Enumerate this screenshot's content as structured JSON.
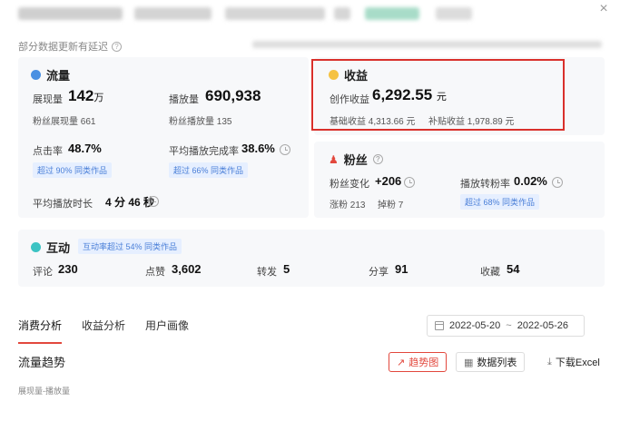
{
  "header": {
    "close_icon": "close-icon"
  },
  "notice": {
    "text": "部分数据更新有延迟"
  },
  "traffic": {
    "title": "流量",
    "impressions_label": "展现量",
    "impressions_value": "142",
    "impressions_unit": "万",
    "plays_label": "播放量",
    "plays_value": "690,938",
    "fan_impressions": "粉丝展现量 661",
    "fan_plays": "粉丝播放量 135",
    "ctr_label": "点击率",
    "ctr_value": "48.7%",
    "ctr_badge": "超过 90% 同类作品",
    "completion_label": "平均播放完成率",
    "completion_value": "38.6%",
    "completion_badge": "超过 66% 同类作品",
    "duration_label": "平均播放时长",
    "duration_value": "4 分 46 秒"
  },
  "revenue": {
    "title": "收益",
    "creation_label": "创作收益",
    "creation_value": "6,292.55",
    "creation_unit": "元",
    "base_label": "基础收益",
    "base_value": "4,313.66 元",
    "subsidy_label": "补贴收益",
    "subsidy_value": "1,978.89 元"
  },
  "fans": {
    "title": "粉丝",
    "change_label": "粉丝变化",
    "change_value": "+206",
    "gain_text": "涨粉 213",
    "loss_text": "掉粉 7",
    "conversion_label": "播放转粉率",
    "conversion_value": "0.02%",
    "conversion_badge": "超过 68% 同类作品"
  },
  "interaction": {
    "title": "互动",
    "badge": "互动率超过 54% 同类作品",
    "comments_label": "评论",
    "comments_value": "230",
    "likes_label": "点赞",
    "likes_value": "3,602",
    "shares_label": "转发",
    "shares_value": "5",
    "shares2_label": "分享",
    "shares2_value": "91",
    "favorites_label": "收藏",
    "favorites_value": "54"
  },
  "tabs": [
    "消费分析",
    "收益分析",
    "用户画像"
  ],
  "date_range": {
    "start": "2022-05-20",
    "separator": "~",
    "end": "2022-05-26"
  },
  "trend": {
    "title": "流量趋势",
    "trend_button": "趋势图",
    "list_button": "数据列表",
    "download_button": "下载Excel",
    "legend_label": "展现量-播放量"
  },
  "colors": {
    "accent": "#e2483d",
    "badge_text": "#4a7fd8",
    "card_bg": "#f7f8fa",
    "highlight": "#d9302b"
  }
}
